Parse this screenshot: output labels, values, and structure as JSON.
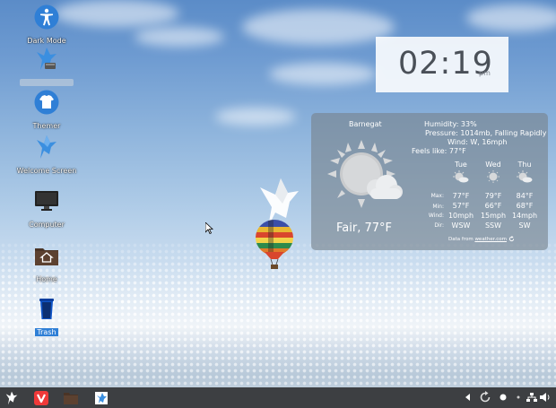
{
  "desktop_icons": [
    {
      "label": "Dark Mode",
      "icon": "accessibility-icon"
    },
    {
      "label": "",
      "icon": "bird-drive-icon"
    },
    {
      "label": "Themer",
      "icon": "tshirt-icon"
    },
    {
      "label": "Welcome Screen",
      "icon": "bird-icon"
    },
    {
      "label": "Computer",
      "icon": "monitor-icon"
    },
    {
      "label": "Home",
      "icon": "home-folder-icon"
    },
    {
      "label": "Trash",
      "icon": "trash-icon",
      "selected": true
    }
  ],
  "clock": {
    "time": "02:19",
    "ampm": "pm"
  },
  "weather": {
    "location": "Barnegat",
    "condition": "Fair, 77°F",
    "humidity": "Humidity: 33%",
    "pressure": "Pressure: 1014mb, Falling Rapidly",
    "wind": "Wind: W, 16mph",
    "feels_like": "Feels like: 77°F",
    "row_labels": {
      "max": "Max:",
      "min": "Min:",
      "wind": "Wind:",
      "dir": "Dir:"
    },
    "forecast": [
      {
        "day": "Tue",
        "max": "77°F",
        "min": "57°F",
        "wind": "10mph",
        "dir": "WSW",
        "icon": "partly-cloudy-icon"
      },
      {
        "day": "Wed",
        "max": "79°F",
        "min": "66°F",
        "wind": "15mph",
        "dir": "SSW",
        "icon": "sun-icon"
      },
      {
        "day": "Thu",
        "max": "84°F",
        "min": "68°F",
        "wind": "14mph",
        "dir": "SW",
        "icon": "partly-cloudy-icon"
      }
    ],
    "source_prefix": "Data from",
    "source_link": "weather.com"
  },
  "taskbar": {
    "apps": [
      "menu-bird-icon",
      "vivaldi-icon",
      "files-folder-icon",
      "welcome-bird-icon"
    ],
    "tray": [
      "chevron-left-icon",
      "refresh-icon",
      "dot-icon",
      "network-icon",
      "volume-icon"
    ]
  },
  "colors": {
    "taskbar": "#3d3f42",
    "selection": "#2f7fd6",
    "vivaldi": "#ef3939"
  }
}
